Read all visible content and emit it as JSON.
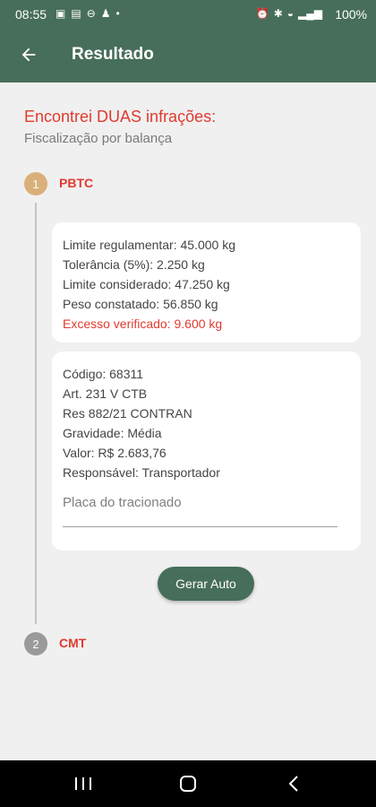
{
  "status_bar": {
    "time": "08:55",
    "battery": "100%"
  },
  "app_bar": {
    "title": "Resultado"
  },
  "content": {
    "headline": "Encontrei DUAS infrações:",
    "subtitle": "Fiscalização por balança",
    "steps": [
      {
        "number": "1",
        "label": "PBTC"
      },
      {
        "number": "2",
        "label": "CMT"
      }
    ],
    "summary_card": {
      "lines": [
        "Limite regulamentar: 45.000 kg",
        "Tolerância (5%): 2.250 kg",
        "Limite considerado: 47.250 kg",
        "Peso constatado: 56.850 kg",
        "Excesso verificado: 9.600 kg"
      ]
    },
    "infraction_card": {
      "lines": [
        "Código: 68311",
        "Art. 231 V CTB",
        "Res 882/21 CONTRAN",
        "Gravidade: Média",
        "Valor: R$ 2.683,76",
        "Responsável: Transportador"
      ],
      "placa_placeholder": "Placa do tracionado"
    },
    "generate_button": "Gerar Auto"
  },
  "colors": {
    "primary": "#476e5a",
    "alert_red": "#e03a2f",
    "step_active": "#d9b07a",
    "step_inactive": "#9a9a9a"
  }
}
